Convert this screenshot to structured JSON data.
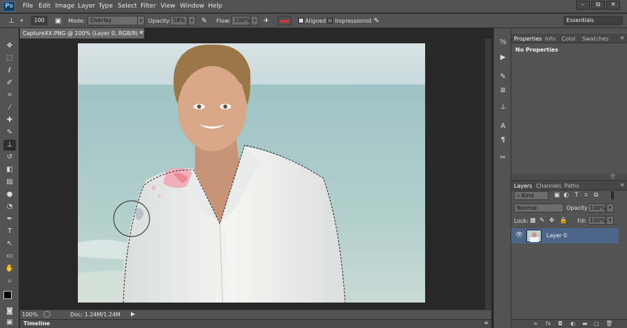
{
  "app": {
    "logo": "Ps"
  },
  "menu": [
    "File",
    "Edit",
    "Image",
    "Layer",
    "Type",
    "Select",
    "Filter",
    "View",
    "Window",
    "Help"
  ],
  "window_buttons": [
    "–",
    "⧉",
    "✕"
  ],
  "options": {
    "brush_size": "100",
    "mode_label": "Mode:",
    "mode_value": "Overlay",
    "opacity_label": "Opacity:",
    "opacity_value": "58%",
    "flow_label": "Flow:",
    "flow_value": "100%",
    "aligned_label": "Aligned",
    "impressionist_label": "Impressionist",
    "workspace": "Essentials"
  },
  "document": {
    "tab_title": "CaptureXX.PNG @ 100% (Layer 0, RGB/8) *",
    "close": "×",
    "zoom": "100%",
    "doc_info": "Doc: 1.24M/1.24M",
    "timeline_label": "Timeline"
  },
  "panels": {
    "top_tabs": [
      "Properties",
      "Info",
      "Color",
      "Swatches"
    ],
    "properties_text": "No Properties",
    "layer_tabs": [
      "Layers",
      "Channels",
      "Paths"
    ],
    "kind_label": "Kind",
    "blend_mode": "Normal",
    "opacity_label": "Opacity:",
    "opacity_value": "100%",
    "lock_label": "Lock:",
    "fill_label": "Fill:",
    "fill_value": "100%",
    "layer_name": "Layer 0"
  },
  "colors": {
    "chrome": "#535353",
    "canvas_bg": "#282828",
    "selected_layer": "#4d6588"
  }
}
